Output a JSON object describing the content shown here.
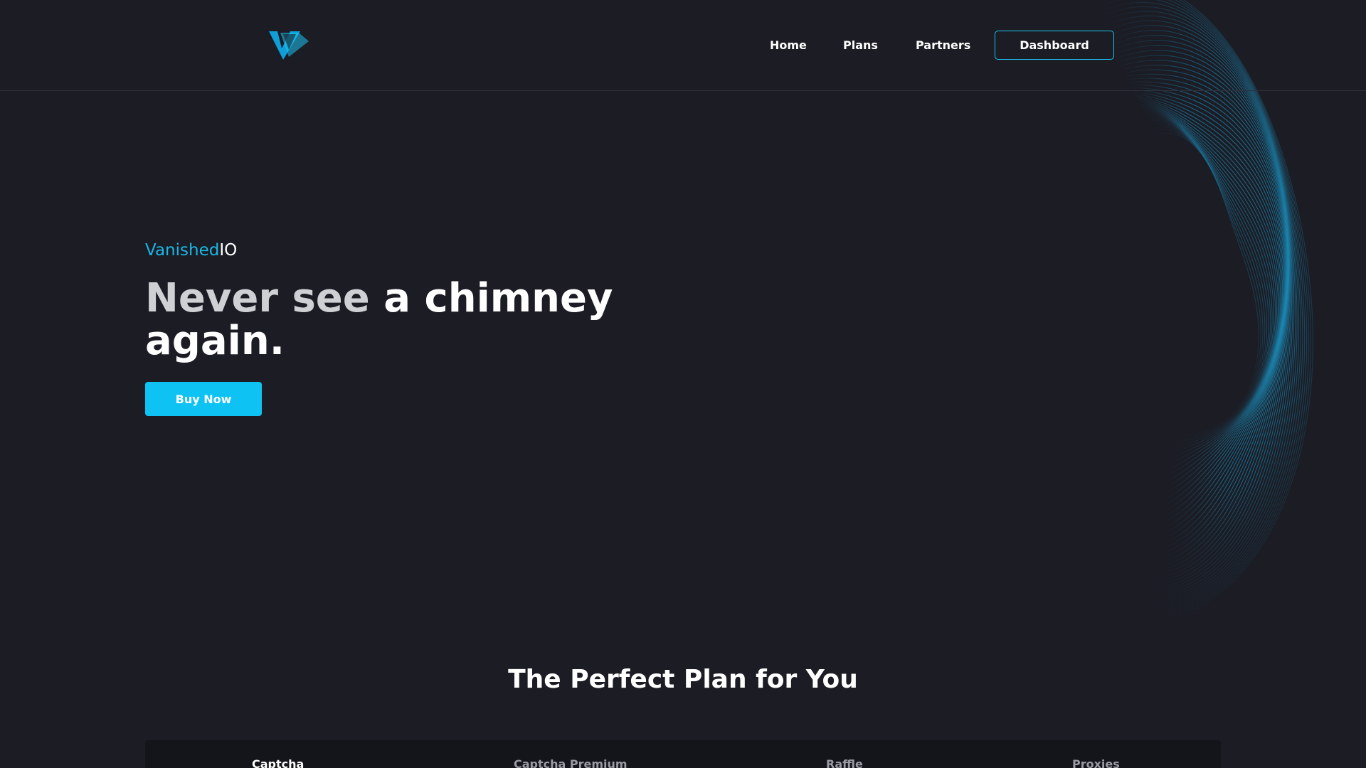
{
  "header": {
    "logo_icon": "vanished-logo-icon",
    "nav": {
      "home": "Home",
      "plans": "Plans",
      "partners": "Partners"
    },
    "dashboard_label": "Dashboard"
  },
  "hero": {
    "brand_accent": "Vanished",
    "brand_rest": "IO",
    "title_dim": "Never see",
    "title_bright": " a chimney again.",
    "buy_label": "Buy Now"
  },
  "plans": {
    "title": "The Perfect Plan for You",
    "tabs": [
      "Captcha",
      "Captcha Premium",
      "Raffle",
      "Proxies"
    ],
    "active_tab": "Captcha"
  },
  "colors": {
    "background": "#1b1c24",
    "accent": "#0ec3f3",
    "tab_bar": "#14151b"
  }
}
